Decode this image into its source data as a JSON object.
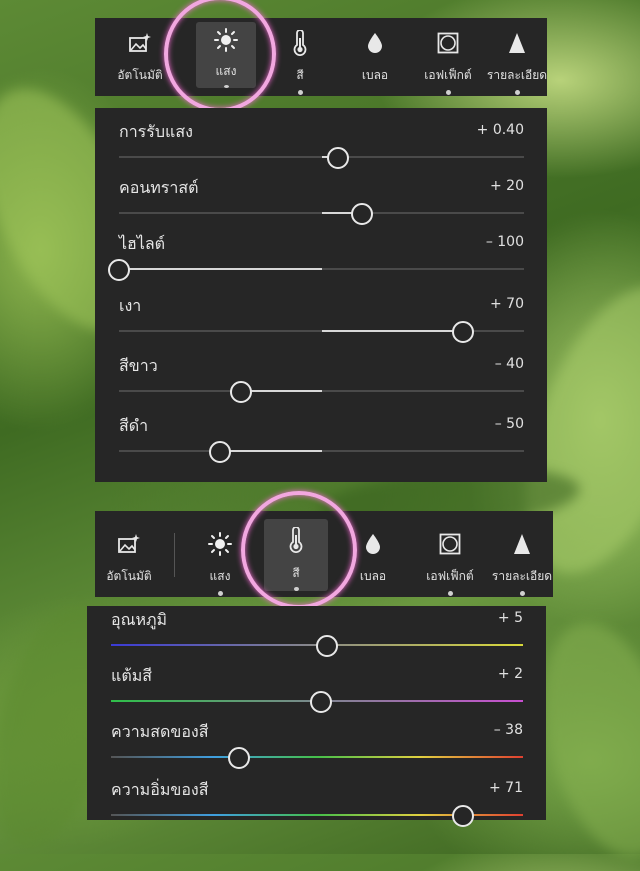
{
  "toolbar_top": {
    "tools": [
      {
        "label": "อัตโนมัติ",
        "icon": "auto-image-icon",
        "active": false
      },
      {
        "label": "แสง",
        "icon": "sun-icon",
        "active": true
      },
      {
        "label": "สี",
        "icon": "thermometer-icon",
        "active": false
      },
      {
        "label": "เบลอ",
        "icon": "droplet-icon",
        "active": false
      },
      {
        "label": "เอฟเฟ็กต์",
        "icon": "vignette-icon",
        "active": false
      },
      {
        "label": "รายละเอียด",
        "icon": "triangle-icon",
        "active": false
      }
    ]
  },
  "light_panel": {
    "sliders": [
      {
        "label": "การรับแสง",
        "value_text": "+ 0.40",
        "value": 0.4,
        "min": -5,
        "max": 5
      },
      {
        "label": "คอนทราสต์",
        "value_text": "+ 20",
        "value": 20,
        "min": -100,
        "max": 100
      },
      {
        "label": "ไฮไลต์",
        "value_text": "– 100",
        "value": -100,
        "min": -100,
        "max": 100
      },
      {
        "label": "เงา",
        "value_text": "+ 70",
        "value": 70,
        "min": -100,
        "max": 100
      },
      {
        "label": "สีขาว",
        "value_text": "– 40",
        "value": -40,
        "min": -100,
        "max": 100
      },
      {
        "label": "สีดำ",
        "value_text": "– 50",
        "value": -50,
        "min": -100,
        "max": 100
      }
    ]
  },
  "toolbar_bottom": {
    "tools": [
      {
        "label": "อัตโนมัติ",
        "icon": "auto-image-icon",
        "active": false
      },
      {
        "label": "แสง",
        "icon": "sun-icon",
        "active": false
      },
      {
        "label": "สี",
        "icon": "thermometer-icon",
        "active": true
      },
      {
        "label": "เบลอ",
        "icon": "droplet-icon",
        "active": false
      },
      {
        "label": "เอฟเฟ็กต์",
        "icon": "vignette-icon",
        "active": false
      },
      {
        "label": "รายละเอียด",
        "icon": "triangle-icon",
        "active": false
      }
    ]
  },
  "color_panel": {
    "sliders": [
      {
        "label": "อุณหภูมิ",
        "value_text": "+ 5",
        "value": 5,
        "min": -100,
        "max": 100,
        "gradient": [
          "#3a3ad6",
          "#d9d93a"
        ]
      },
      {
        "label": "แต้มสี",
        "value_text": "+ 2",
        "value": 2,
        "min": -100,
        "max": 100,
        "gradient": [
          "#2fbf4a",
          "#c84fd0"
        ]
      },
      {
        "label": "ความสดของสี",
        "value_text": "– 38",
        "value": -38,
        "min": -100,
        "max": 100,
        "gradient": [
          "#555555",
          "#3f9fe0",
          "#45c04a",
          "#e0d040",
          "#e04030"
        ]
      },
      {
        "label": "ความอิ่มของสี",
        "value_text": "+ 71",
        "value": 71,
        "min": -100,
        "max": 100,
        "gradient": [
          "#555555",
          "#3f9fe0",
          "#45c04a",
          "#e0d040",
          "#e04030"
        ]
      }
    ]
  },
  "highlight_color": "#f2a7e0"
}
